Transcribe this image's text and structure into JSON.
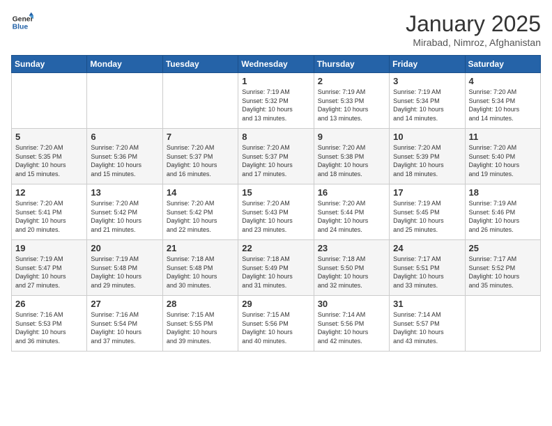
{
  "header": {
    "logo_general": "General",
    "logo_blue": "Blue",
    "month_title": "January 2025",
    "subtitle": "Mirabad, Nimroz, Afghanistan"
  },
  "weekdays": [
    "Sunday",
    "Monday",
    "Tuesday",
    "Wednesday",
    "Thursday",
    "Friday",
    "Saturday"
  ],
  "weeks": [
    [
      {
        "day": "",
        "info": ""
      },
      {
        "day": "",
        "info": ""
      },
      {
        "day": "",
        "info": ""
      },
      {
        "day": "1",
        "info": "Sunrise: 7:19 AM\nSunset: 5:32 PM\nDaylight: 10 hours\nand 13 minutes."
      },
      {
        "day": "2",
        "info": "Sunrise: 7:19 AM\nSunset: 5:33 PM\nDaylight: 10 hours\nand 13 minutes."
      },
      {
        "day": "3",
        "info": "Sunrise: 7:19 AM\nSunset: 5:34 PM\nDaylight: 10 hours\nand 14 minutes."
      },
      {
        "day": "4",
        "info": "Sunrise: 7:20 AM\nSunset: 5:34 PM\nDaylight: 10 hours\nand 14 minutes."
      }
    ],
    [
      {
        "day": "5",
        "info": "Sunrise: 7:20 AM\nSunset: 5:35 PM\nDaylight: 10 hours\nand 15 minutes."
      },
      {
        "day": "6",
        "info": "Sunrise: 7:20 AM\nSunset: 5:36 PM\nDaylight: 10 hours\nand 15 minutes."
      },
      {
        "day": "7",
        "info": "Sunrise: 7:20 AM\nSunset: 5:37 PM\nDaylight: 10 hours\nand 16 minutes."
      },
      {
        "day": "8",
        "info": "Sunrise: 7:20 AM\nSunset: 5:37 PM\nDaylight: 10 hours\nand 17 minutes."
      },
      {
        "day": "9",
        "info": "Sunrise: 7:20 AM\nSunset: 5:38 PM\nDaylight: 10 hours\nand 18 minutes."
      },
      {
        "day": "10",
        "info": "Sunrise: 7:20 AM\nSunset: 5:39 PM\nDaylight: 10 hours\nand 18 minutes."
      },
      {
        "day": "11",
        "info": "Sunrise: 7:20 AM\nSunset: 5:40 PM\nDaylight: 10 hours\nand 19 minutes."
      }
    ],
    [
      {
        "day": "12",
        "info": "Sunrise: 7:20 AM\nSunset: 5:41 PM\nDaylight: 10 hours\nand 20 minutes."
      },
      {
        "day": "13",
        "info": "Sunrise: 7:20 AM\nSunset: 5:42 PM\nDaylight: 10 hours\nand 21 minutes."
      },
      {
        "day": "14",
        "info": "Sunrise: 7:20 AM\nSunset: 5:42 PM\nDaylight: 10 hours\nand 22 minutes."
      },
      {
        "day": "15",
        "info": "Sunrise: 7:20 AM\nSunset: 5:43 PM\nDaylight: 10 hours\nand 23 minutes."
      },
      {
        "day": "16",
        "info": "Sunrise: 7:20 AM\nSunset: 5:44 PM\nDaylight: 10 hours\nand 24 minutes."
      },
      {
        "day": "17",
        "info": "Sunrise: 7:19 AM\nSunset: 5:45 PM\nDaylight: 10 hours\nand 25 minutes."
      },
      {
        "day": "18",
        "info": "Sunrise: 7:19 AM\nSunset: 5:46 PM\nDaylight: 10 hours\nand 26 minutes."
      }
    ],
    [
      {
        "day": "19",
        "info": "Sunrise: 7:19 AM\nSunset: 5:47 PM\nDaylight: 10 hours\nand 27 minutes."
      },
      {
        "day": "20",
        "info": "Sunrise: 7:19 AM\nSunset: 5:48 PM\nDaylight: 10 hours\nand 29 minutes."
      },
      {
        "day": "21",
        "info": "Sunrise: 7:18 AM\nSunset: 5:48 PM\nDaylight: 10 hours\nand 30 minutes."
      },
      {
        "day": "22",
        "info": "Sunrise: 7:18 AM\nSunset: 5:49 PM\nDaylight: 10 hours\nand 31 minutes."
      },
      {
        "day": "23",
        "info": "Sunrise: 7:18 AM\nSunset: 5:50 PM\nDaylight: 10 hours\nand 32 minutes."
      },
      {
        "day": "24",
        "info": "Sunrise: 7:17 AM\nSunset: 5:51 PM\nDaylight: 10 hours\nand 33 minutes."
      },
      {
        "day": "25",
        "info": "Sunrise: 7:17 AM\nSunset: 5:52 PM\nDaylight: 10 hours\nand 35 minutes."
      }
    ],
    [
      {
        "day": "26",
        "info": "Sunrise: 7:16 AM\nSunset: 5:53 PM\nDaylight: 10 hours\nand 36 minutes."
      },
      {
        "day": "27",
        "info": "Sunrise: 7:16 AM\nSunset: 5:54 PM\nDaylight: 10 hours\nand 37 minutes."
      },
      {
        "day": "28",
        "info": "Sunrise: 7:15 AM\nSunset: 5:55 PM\nDaylight: 10 hours\nand 39 minutes."
      },
      {
        "day": "29",
        "info": "Sunrise: 7:15 AM\nSunset: 5:56 PM\nDaylight: 10 hours\nand 40 minutes."
      },
      {
        "day": "30",
        "info": "Sunrise: 7:14 AM\nSunset: 5:56 PM\nDaylight: 10 hours\nand 42 minutes."
      },
      {
        "day": "31",
        "info": "Sunrise: 7:14 AM\nSunset: 5:57 PM\nDaylight: 10 hours\nand 43 minutes."
      },
      {
        "day": "",
        "info": ""
      }
    ]
  ]
}
